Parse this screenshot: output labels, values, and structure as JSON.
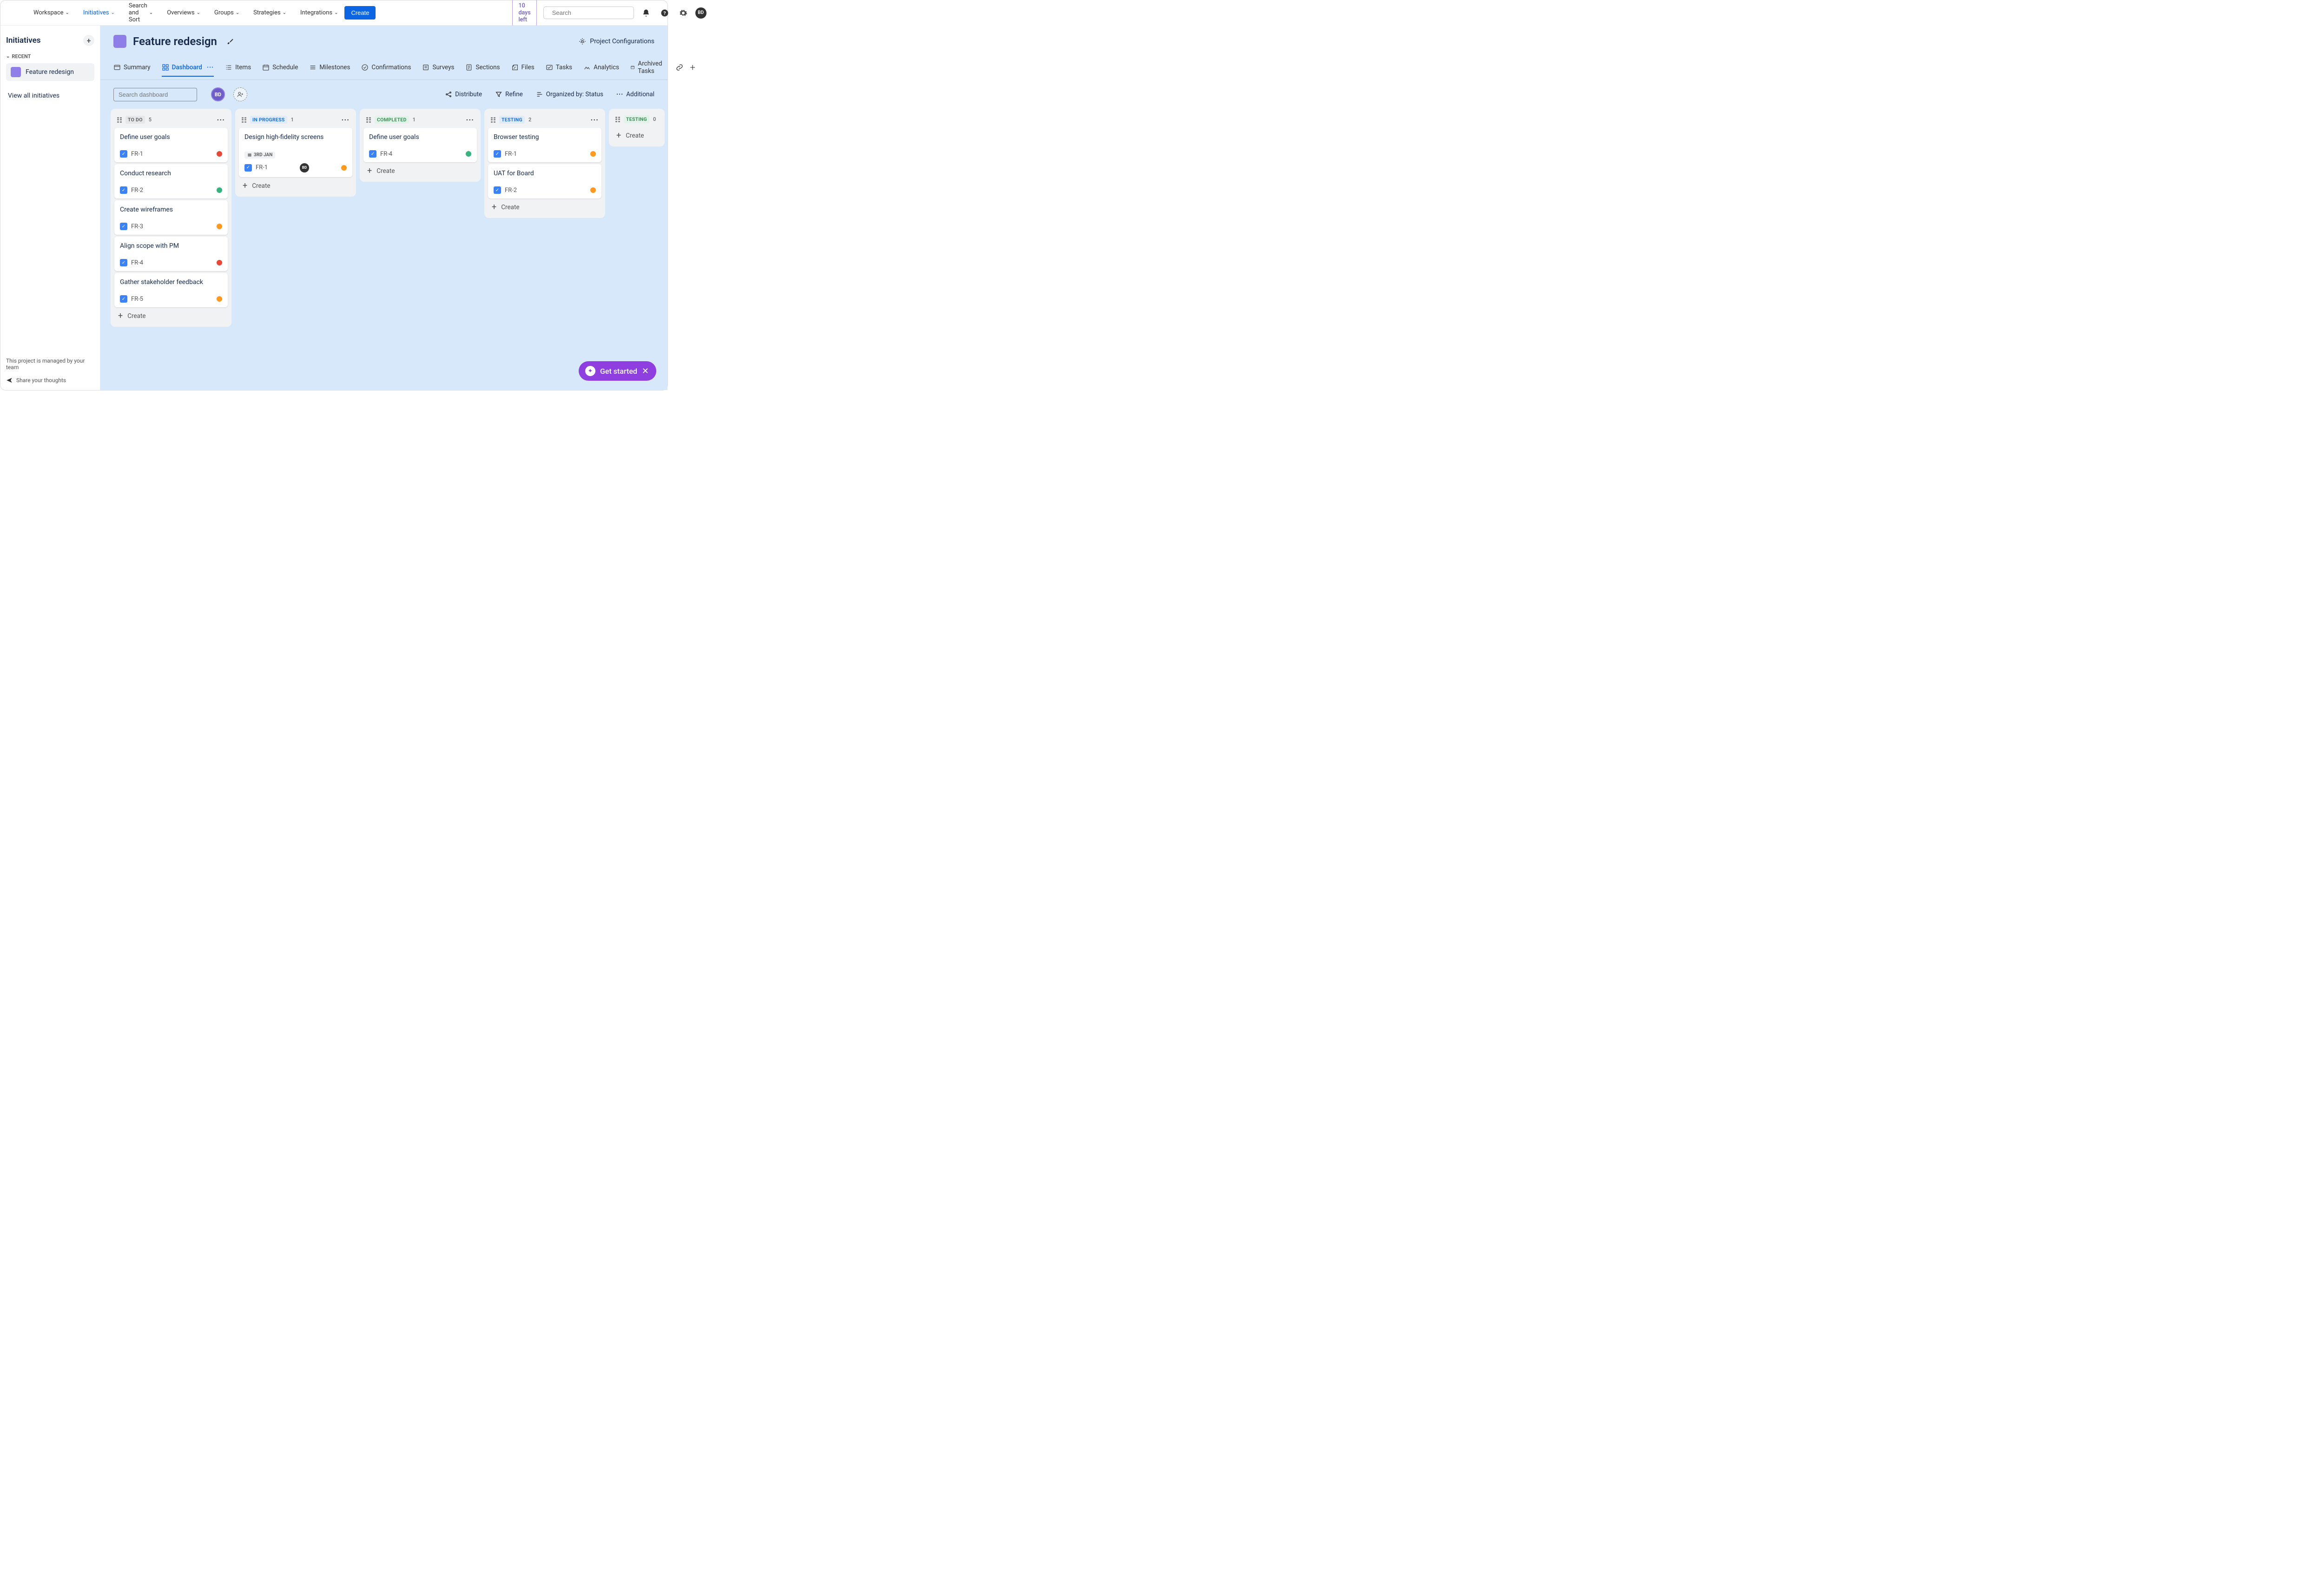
{
  "nav": {
    "menus": [
      "Workspace",
      "Initiatives",
      "Search and Sort",
      "Overviews",
      "Groups",
      "Strategies",
      "Integrations"
    ],
    "activeIndex": 1,
    "create": "Create",
    "trial": "10 days left",
    "searchPlaceholder": "Search",
    "avatar": "BD"
  },
  "sidebar": {
    "title": "Initiatives",
    "recent": "RECENT",
    "item": "Feature redesign",
    "viewAll": "View all initiatives",
    "footer1": "This project is managed by your team",
    "footer2": "Share your thoughts"
  },
  "project": {
    "title": "Feature redesign",
    "config": "Project Configurations"
  },
  "tabs": [
    "Summary",
    "Dashboard",
    "Items",
    "Schedule",
    "Milestones",
    "Confirmations",
    "Surveys",
    "Sections",
    "Files",
    "Tasks",
    "Analytics",
    "Archived Tasks"
  ],
  "tabActive": 1,
  "toolbar": {
    "searchPlaceholder": "Search dashboard",
    "avatar": "BD",
    "distribute": "Distribute",
    "refine": "Refine",
    "organized": "Organized by: Status",
    "additional": "Additional"
  },
  "columns": [
    {
      "name": "TO DO",
      "style": "todo",
      "count": 5,
      "cards": [
        {
          "title": "Define user goals",
          "key": "FR-1",
          "prio": "red"
        },
        {
          "title": "Conduct research",
          "key": "FR-2",
          "prio": "green"
        },
        {
          "title": "Create wireframes",
          "key": "FR-3",
          "prio": "orange"
        },
        {
          "title": "Align scope with PM",
          "key": "FR-4",
          "prio": "red"
        },
        {
          "title": "Gather stakeholder feedback",
          "key": "FR-5",
          "prio": "orange"
        }
      ]
    },
    {
      "name": "IN PROGRESS",
      "style": "inprog",
      "count": 1,
      "cards": [
        {
          "title": "Design high-fidelity screens",
          "key": "FR-1",
          "prio": "orange",
          "date": "3RD JAN",
          "assignee": "BD"
        }
      ]
    },
    {
      "name": "COMPLETED",
      "style": "done",
      "count": 1,
      "cards": [
        {
          "title": "Define user goals",
          "key": "FR-4",
          "prio": "green"
        }
      ]
    },
    {
      "name": "TESTING",
      "style": "inprog",
      "count": 2,
      "cards": [
        {
          "title": "Browser testing",
          "key": "FR-1",
          "prio": "orange"
        },
        {
          "title": "UAT for Board",
          "key": "FR-2",
          "prio": "orange"
        }
      ]
    },
    {
      "name": "TESTING",
      "style": "test",
      "count": 0,
      "narrow": true,
      "cards": []
    }
  ],
  "createLabel": "Create",
  "getStarted": "Get started"
}
